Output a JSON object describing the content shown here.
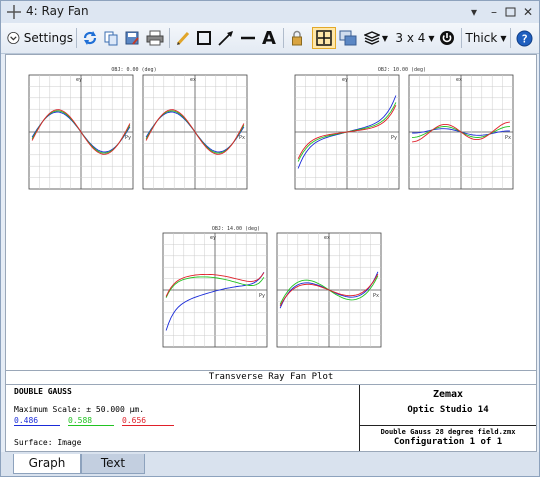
{
  "window": {
    "title": "4: Ray Fan"
  },
  "toolbar": {
    "settings_label": "Settings",
    "layout_label": "3 x 4",
    "thickness_label": "Thick",
    "draw_text_glyph": "A"
  },
  "plot": {
    "fields": [
      {
        "label": "OBJ: 0.00 (deg)",
        "tan_axis": "ey",
        "sag_axis": "ex",
        "tan_x": "Py",
        "sag_x": "Px"
      },
      {
        "label": "OBJ: 10.00 (deg)",
        "tan_axis": "ey",
        "sag_axis": "ex",
        "tan_x": "Py",
        "sag_x": "Px"
      },
      {
        "label": "OBJ: 14.00 (deg)",
        "tan_axis": "ey",
        "sag_axis": "ex",
        "tan_x": "Py",
        "sag_x": "Px"
      }
    ],
    "caption": "Transverse Ray Fan Plot"
  },
  "info": {
    "lens_title": "DOUBLE GAUSS",
    "max_scale": "Maximum Scale: ± 50.000 µm.",
    "wavelengths": [
      {
        "value": "0.486",
        "color": "#1a2bd8"
      },
      {
        "value": "0.588",
        "color": "#22c322"
      },
      {
        "value": "0.656",
        "color": "#e0202a"
      }
    ],
    "surface": "Surface: Image",
    "company": "Zemax",
    "product": "Optic Studio 14",
    "file": "Double Gauss 28 degree field.zmx",
    "configuration": "Configuration 1 of 1"
  },
  "tabs": [
    {
      "label": "Graph",
      "active": true
    },
    {
      "label": "Text",
      "active": false
    }
  ],
  "colors": {
    "blue": "#1a2bd8",
    "green": "#22c322",
    "red": "#e0202a",
    "accent": "#f0c040"
  }
}
